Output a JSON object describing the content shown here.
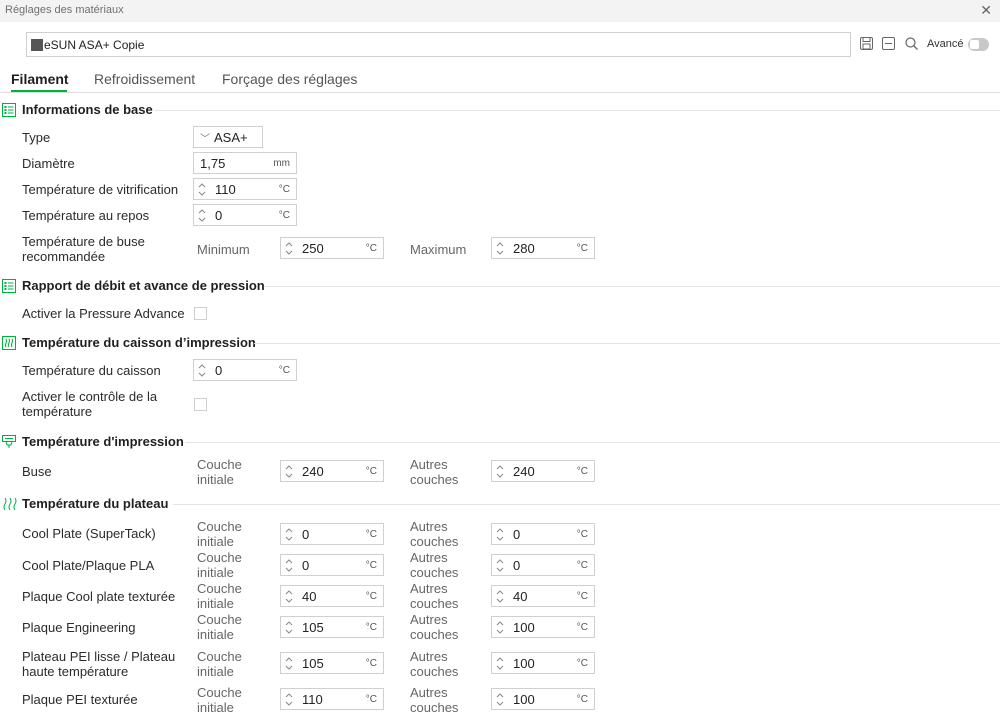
{
  "window": {
    "title": "Réglages des matériaux",
    "close_glyph": "✕"
  },
  "preset": {
    "name": "eSUN ASA+ Copie",
    "swatch_color": "#555555"
  },
  "toolbar": {
    "advanced_label": "Avancé",
    "advanced_on": false
  },
  "tabs": [
    "Filament",
    "Refroidissement",
    "Forçage des réglages"
  ],
  "active_tab": 0,
  "sections": {
    "basic": {
      "title": "Informations de base",
      "icon": "list-icon",
      "type_label": "Type",
      "type_value": "ASA+",
      "diameter_label": "Diamètre",
      "diameter_value": "1,75",
      "diameter_unit": "mm",
      "vitrification_label": "Température de vitrification",
      "vitrification_value": "110",
      "rest_label": "Température au repos",
      "rest_value": "0",
      "nozzle_rec_label_1": "Température de buse",
      "nozzle_rec_label_2": "recommandée",
      "min_label": "Minimum",
      "min_value": "250",
      "max_label": "Maximum",
      "max_value": "280",
      "unit_c": "°C"
    },
    "flow": {
      "title": "Rapport de débit et avance de pression",
      "icon": "list-icon",
      "pa_label": "Activer la Pressure Advance",
      "pa_checked": false
    },
    "chamber": {
      "title": "Température du caisson d’impression",
      "icon": "chamber-icon",
      "temp_label": "Température du caisson",
      "temp_value": "0",
      "control_label_1": "Activer le contrôle de la",
      "control_label_2": "température",
      "control_checked": false
    },
    "print": {
      "title": "Température d'impression",
      "icon": "nozzle-icon",
      "nozzle_label": "Buse",
      "initial_1": "Couche",
      "initial_2": "initiale",
      "initial_value": "240",
      "other_1": "Autres",
      "other_2": "couches",
      "other_value": "240"
    },
    "plate": {
      "title": "Température du plateau",
      "icon": "heat-icon",
      "initial_1": "Couche",
      "initial_2": "initiale",
      "other_1": "Autres",
      "other_2": "couches",
      "rows": [
        {
          "name": "Cool Plate (SuperTack)",
          "initial": "0",
          "other": "0"
        },
        {
          "name": "Cool Plate/Plaque PLA",
          "initial": "0",
          "other": "0"
        },
        {
          "name": "Plaque Cool plate texturée",
          "initial": "40",
          "other": "40"
        },
        {
          "name": "Plaque Engineering",
          "initial": "105",
          "other": "100"
        },
        {
          "name_1": "Plateau PEI lisse / Plateau",
          "name_2": "haute température",
          "initial": "105",
          "other": "100"
        },
        {
          "name": "Plaque PEI texturée",
          "initial": "110",
          "other": "100"
        }
      ]
    }
  },
  "colors": {
    "accent": "#00ae42",
    "border": "#d0d0d0"
  }
}
